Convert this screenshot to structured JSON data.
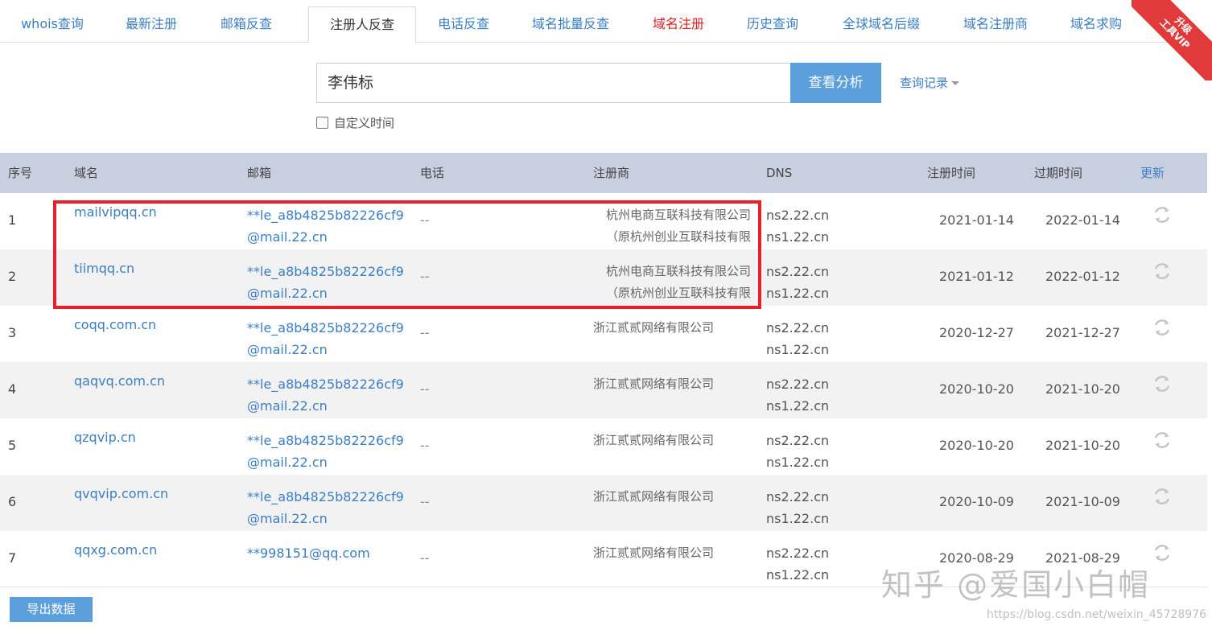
{
  "tabs": [
    {
      "label": "whois查询"
    },
    {
      "label": "最新注册"
    },
    {
      "label": "邮箱反查"
    },
    {
      "label": "注册人反查"
    },
    {
      "label": "电话反查"
    },
    {
      "label": "域名批量反查"
    },
    {
      "label": "域名注册"
    },
    {
      "label": "历史查询"
    },
    {
      "label": "全球域名后缀"
    },
    {
      "label": "域名注册商"
    },
    {
      "label": "域名求购"
    }
  ],
  "ribbon": {
    "line1": "升级",
    "line2": "工具VIP",
    "color": "#e03a3a"
  },
  "search": {
    "value": "李伟标",
    "button": "查看分析",
    "history": "查询记录"
  },
  "custom_time": {
    "label": "自定义时间"
  },
  "table": {
    "headers": {
      "num": "序号",
      "domain": "域名",
      "email": "邮箱",
      "phone": "电话",
      "registrar": "注册商",
      "dns": "DNS",
      "reg_date": "注册时间",
      "exp_date": "过期时间",
      "refresh": "更新"
    },
    "rows": [
      {
        "num": "1",
        "domain": "mailvipqq.cn",
        "email1": "**le_a8b4825b82226cf9",
        "email2": "@mail.22.cn",
        "phone": "--",
        "reg1": "杭州电商互联科技有限公司",
        "reg2": "（原杭州创业互联科技有限",
        "dns1": "ns2.22.cn",
        "dns2": "ns1.22.cn",
        "reg_date": "2021-01-14",
        "exp_date": "2022-01-14"
      },
      {
        "num": "2",
        "domain": "tiimqq.cn",
        "email1": "**le_a8b4825b82226cf9",
        "email2": "@mail.22.cn",
        "phone": "--",
        "reg1": "杭州电商互联科技有限公司",
        "reg2": "（原杭州创业互联科技有限",
        "dns1": "ns2.22.cn",
        "dns2": "ns1.22.cn",
        "reg_date": "2021-01-12",
        "exp_date": "2022-01-12"
      },
      {
        "num": "3",
        "domain": "coqq.com.cn",
        "email1": "**le_a8b4825b82226cf9",
        "email2": "@mail.22.cn",
        "phone": "--",
        "reg1": "浙江贰贰网络有限公司",
        "reg2": "",
        "dns1": "ns2.22.cn",
        "dns2": "ns1.22.cn",
        "reg_date": "2020-12-27",
        "exp_date": "2021-12-27"
      },
      {
        "num": "4",
        "domain": "qaqvq.com.cn",
        "email1": "**le_a8b4825b82226cf9",
        "email2": "@mail.22.cn",
        "phone": "--",
        "reg1": "浙江贰贰网络有限公司",
        "reg2": "",
        "dns1": "ns2.22.cn",
        "dns2": "ns1.22.cn",
        "reg_date": "2020-10-20",
        "exp_date": "2021-10-20"
      },
      {
        "num": "5",
        "domain": "qzqvip.cn",
        "email1": "**le_a8b4825b82226cf9",
        "email2": "@mail.22.cn",
        "phone": "--",
        "reg1": "浙江贰贰网络有限公司",
        "reg2": "",
        "dns1": "ns2.22.cn",
        "dns2": "ns1.22.cn",
        "reg_date": "2020-10-20",
        "exp_date": "2021-10-20"
      },
      {
        "num": "6",
        "domain": "qvqvip.com.cn",
        "email1": "**le_a8b4825b82226cf9",
        "email2": "@mail.22.cn",
        "phone": "--",
        "reg1": "浙江贰贰网络有限公司",
        "reg2": "",
        "dns1": "ns2.22.cn",
        "dns2": "ns1.22.cn",
        "reg_date": "2020-10-09",
        "exp_date": "2021-10-09"
      },
      {
        "num": "7",
        "domain": "qqxg.com.cn",
        "email1": "**998151@qq.com",
        "email2": "",
        "phone": "--",
        "reg1": "浙江贰贰网络有限公司",
        "reg2": "",
        "dns1": "ns2.22.cn",
        "dns2": "ns1.22.cn",
        "reg_date": "2020-08-29",
        "exp_date": "2021-08-29"
      }
    ]
  },
  "export_button": "导出数据",
  "watermark": "知乎 @爱国小白帽",
  "url_watermark": "https://blog.csdn.net/weixin_45728976",
  "colors": {
    "link": "#3b7ec3",
    "accent": "#5b9fdc",
    "header_bg": "#c8cfdf",
    "highlight": "#e8202a"
  }
}
